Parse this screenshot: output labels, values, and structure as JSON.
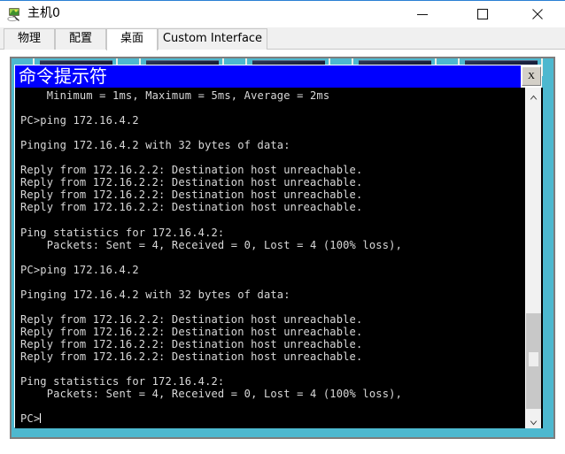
{
  "window": {
    "title": "主机0",
    "icon": "host-pc-icon",
    "controls": {
      "minimize_label": "—",
      "maximize_label": "□",
      "close_label": "✕"
    }
  },
  "tabs": [
    {
      "label": "物理",
      "active": false
    },
    {
      "label": "配置",
      "active": false
    },
    {
      "label": "桌面",
      "active": true
    },
    {
      "label": "Custom Interface",
      "active": false
    }
  ],
  "desktop": {
    "background_color": "#4db8cf",
    "icons": [
      {
        "name": "desktop-shortcut-1"
      },
      {
        "name": "desktop-shortcut-2"
      },
      {
        "name": "desktop-shortcut-3"
      },
      {
        "name": "desktop-shortcut-4"
      },
      {
        "name": "desktop-shortcut-5"
      }
    ]
  },
  "command_prompt": {
    "title": "命令提示符",
    "titlebar_color": "#0000ff",
    "close_button_label": "X",
    "terminal": {
      "background_color": "#000000",
      "text_color": "#d8d8d8",
      "content": "    Minimum = 1ms, Maximum = 5ms, Average = 2ms\n\nPC>ping 172.16.4.2\n\nPinging 172.16.4.2 with 32 bytes of data:\n\nReply from 172.16.2.2: Destination host unreachable.\nReply from 172.16.2.2: Destination host unreachable.\nReply from 172.16.2.2: Destination host unreachable.\nReply from 172.16.2.2: Destination host unreachable.\n\nPing statistics for 172.16.4.2:\n    Packets: Sent = 4, Received = 0, Lost = 4 (100% loss),\n\nPC>ping 172.16.4.2\n\nPinging 172.16.4.2 with 32 bytes of data:\n\nReply from 172.16.2.2: Destination host unreachable.\nReply from 172.16.2.2: Destination host unreachable.\nReply from 172.16.2.2: Destination host unreachable.\nReply from 172.16.2.2: Destination host unreachable.\n\nPing statistics for 172.16.4.2:\n    Packets: Sent = 4, Received = 0, Lost = 4 (100% loss),\n\n",
      "prompt": "PC>"
    },
    "scrollbar": {
      "up_arrow": "^",
      "down_arrow": "v"
    }
  }
}
